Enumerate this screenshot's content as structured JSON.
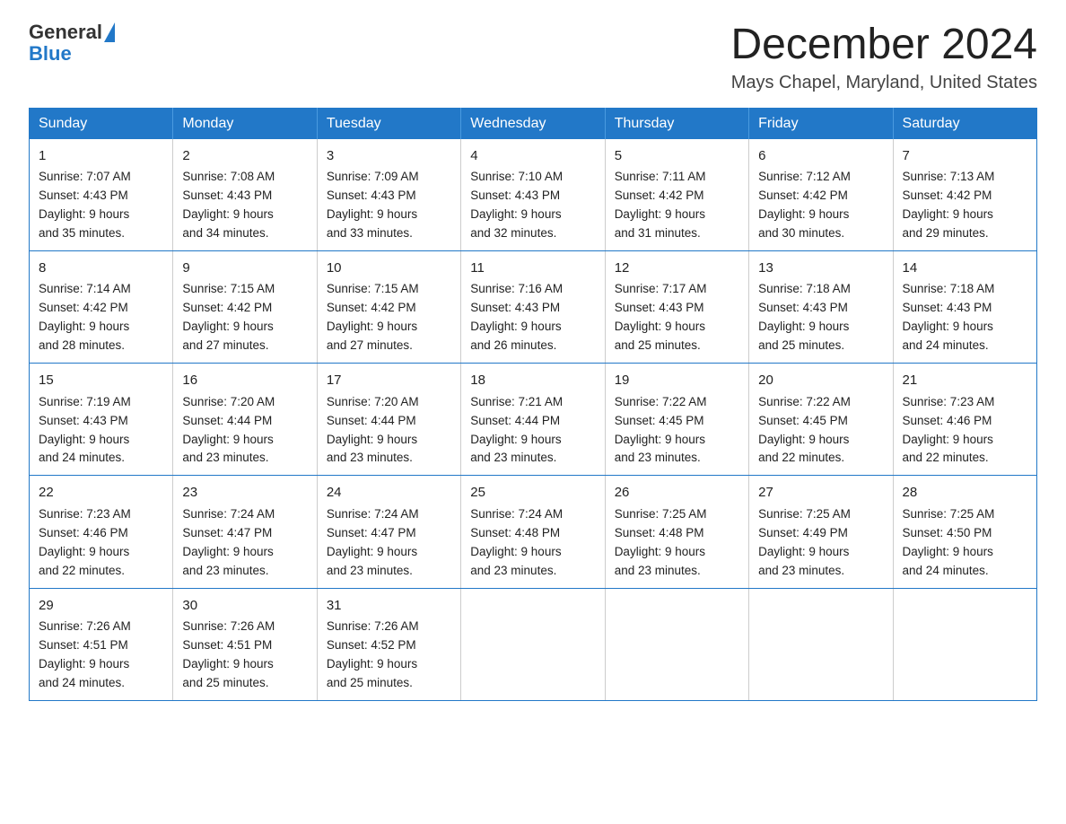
{
  "logo": {
    "general": "General",
    "blue": "Blue"
  },
  "title": {
    "month_year": "December 2024",
    "location": "Mays Chapel, Maryland, United States"
  },
  "weekdays": [
    "Sunday",
    "Monday",
    "Tuesday",
    "Wednesday",
    "Thursday",
    "Friday",
    "Saturday"
  ],
  "weeks": [
    [
      {
        "day": "1",
        "sunrise": "7:07 AM",
        "sunset": "4:43 PM",
        "daylight": "9 hours and 35 minutes."
      },
      {
        "day": "2",
        "sunrise": "7:08 AM",
        "sunset": "4:43 PM",
        "daylight": "9 hours and 34 minutes."
      },
      {
        "day": "3",
        "sunrise": "7:09 AM",
        "sunset": "4:43 PM",
        "daylight": "9 hours and 33 minutes."
      },
      {
        "day": "4",
        "sunrise": "7:10 AM",
        "sunset": "4:43 PM",
        "daylight": "9 hours and 32 minutes."
      },
      {
        "day": "5",
        "sunrise": "7:11 AM",
        "sunset": "4:42 PM",
        "daylight": "9 hours and 31 minutes."
      },
      {
        "day": "6",
        "sunrise": "7:12 AM",
        "sunset": "4:42 PM",
        "daylight": "9 hours and 30 minutes."
      },
      {
        "day": "7",
        "sunrise": "7:13 AM",
        "sunset": "4:42 PM",
        "daylight": "9 hours and 29 minutes."
      }
    ],
    [
      {
        "day": "8",
        "sunrise": "7:14 AM",
        "sunset": "4:42 PM",
        "daylight": "9 hours and 28 minutes."
      },
      {
        "day": "9",
        "sunrise": "7:15 AM",
        "sunset": "4:42 PM",
        "daylight": "9 hours and 27 minutes."
      },
      {
        "day": "10",
        "sunrise": "7:15 AM",
        "sunset": "4:42 PM",
        "daylight": "9 hours and 27 minutes."
      },
      {
        "day": "11",
        "sunrise": "7:16 AM",
        "sunset": "4:43 PM",
        "daylight": "9 hours and 26 minutes."
      },
      {
        "day": "12",
        "sunrise": "7:17 AM",
        "sunset": "4:43 PM",
        "daylight": "9 hours and 25 minutes."
      },
      {
        "day": "13",
        "sunrise": "7:18 AM",
        "sunset": "4:43 PM",
        "daylight": "9 hours and 25 minutes."
      },
      {
        "day": "14",
        "sunrise": "7:18 AM",
        "sunset": "4:43 PM",
        "daylight": "9 hours and 24 minutes."
      }
    ],
    [
      {
        "day": "15",
        "sunrise": "7:19 AM",
        "sunset": "4:43 PM",
        "daylight": "9 hours and 24 minutes."
      },
      {
        "day": "16",
        "sunrise": "7:20 AM",
        "sunset": "4:44 PM",
        "daylight": "9 hours and 23 minutes."
      },
      {
        "day": "17",
        "sunrise": "7:20 AM",
        "sunset": "4:44 PM",
        "daylight": "9 hours and 23 minutes."
      },
      {
        "day": "18",
        "sunrise": "7:21 AM",
        "sunset": "4:44 PM",
        "daylight": "9 hours and 23 minutes."
      },
      {
        "day": "19",
        "sunrise": "7:22 AM",
        "sunset": "4:45 PM",
        "daylight": "9 hours and 23 minutes."
      },
      {
        "day": "20",
        "sunrise": "7:22 AM",
        "sunset": "4:45 PM",
        "daylight": "9 hours and 22 minutes."
      },
      {
        "day": "21",
        "sunrise": "7:23 AM",
        "sunset": "4:46 PM",
        "daylight": "9 hours and 22 minutes."
      }
    ],
    [
      {
        "day": "22",
        "sunrise": "7:23 AM",
        "sunset": "4:46 PM",
        "daylight": "9 hours and 22 minutes."
      },
      {
        "day": "23",
        "sunrise": "7:24 AM",
        "sunset": "4:47 PM",
        "daylight": "9 hours and 23 minutes."
      },
      {
        "day": "24",
        "sunrise": "7:24 AM",
        "sunset": "4:47 PM",
        "daylight": "9 hours and 23 minutes."
      },
      {
        "day": "25",
        "sunrise": "7:24 AM",
        "sunset": "4:48 PM",
        "daylight": "9 hours and 23 minutes."
      },
      {
        "day": "26",
        "sunrise": "7:25 AM",
        "sunset": "4:48 PM",
        "daylight": "9 hours and 23 minutes."
      },
      {
        "day": "27",
        "sunrise": "7:25 AM",
        "sunset": "4:49 PM",
        "daylight": "9 hours and 23 minutes."
      },
      {
        "day": "28",
        "sunrise": "7:25 AM",
        "sunset": "4:50 PM",
        "daylight": "9 hours and 24 minutes."
      }
    ],
    [
      {
        "day": "29",
        "sunrise": "7:26 AM",
        "sunset": "4:51 PM",
        "daylight": "9 hours and 24 minutes."
      },
      {
        "day": "30",
        "sunrise": "7:26 AM",
        "sunset": "4:51 PM",
        "daylight": "9 hours and 25 minutes."
      },
      {
        "day": "31",
        "sunrise": "7:26 AM",
        "sunset": "4:52 PM",
        "daylight": "9 hours and 25 minutes."
      },
      null,
      null,
      null,
      null
    ]
  ],
  "labels": {
    "sunrise": "Sunrise:",
    "sunset": "Sunset:",
    "daylight": "Daylight:"
  }
}
